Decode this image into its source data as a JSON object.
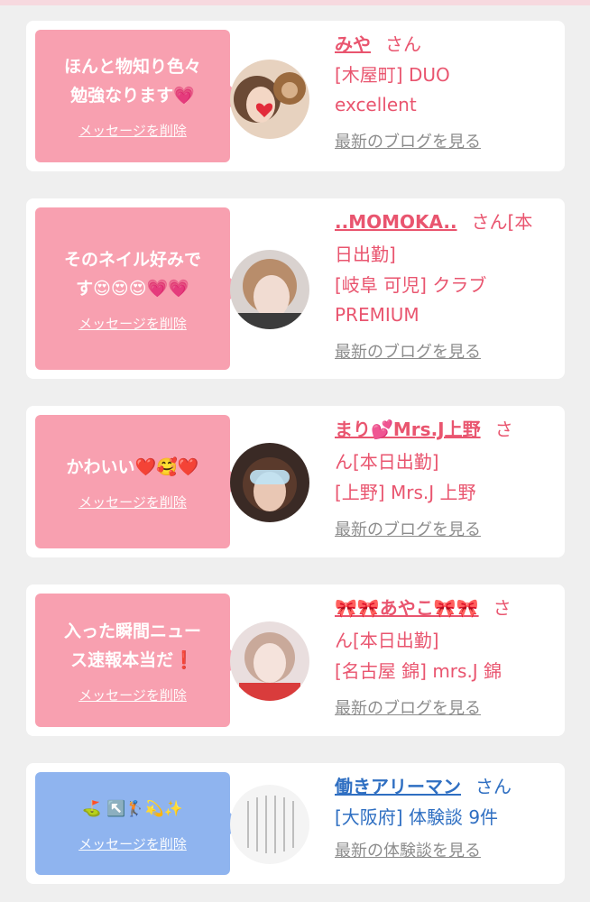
{
  "delete_label": "メッセージを削除",
  "cards": [
    {
      "message_line1": "ほんと物知り色々",
      "message_line2": "勉強なります💗",
      "name": "みや",
      "honorific": "さん",
      "detail_line1": "[木屋町] DUO",
      "detail_line2": "excellent",
      "link": "最新のブログを見る"
    },
    {
      "message_line1": "そのネイル好みで",
      "message_line2": "す😍😍😍💗💗",
      "name": "..MOMOKA..",
      "honorific": "さん[本",
      "name_cont": "日出勤]",
      "detail_line1": "[岐阜 可児] クラブ",
      "detail_line2": "PREMIUM",
      "link": "最新のブログを見る"
    },
    {
      "message_line1": "かわいい❤️🥰❤️",
      "name": "まり💕Mrs.J上野",
      "honorific": "さ",
      "name_cont": "ん[本日出勤]",
      "detail_line1": "[上野] Mrs.J 上野",
      "link": "最新のブログを見る"
    },
    {
      "message_line1": "入った瞬間ニュー",
      "message_line2": "ス速報本当だ❗",
      "name": "🎀🎀あやこ🎀🎀",
      "honorific": "さ",
      "name_cont": "ん[本日出勤]",
      "detail_line1": "[名古屋 錦] mrs.J 錦",
      "link": "最新のブログを見る"
    },
    {
      "message_line1": "⛳ ↖️🏌️💫✨",
      "name": "働きアリーマン",
      "honorific": "さん",
      "detail_line1": "[大阪府] 体験談 9件",
      "link": "最新の体験談を見る"
    }
  ],
  "colors": {
    "pink_bubble": "#f8a0b0",
    "blue_bubble": "#8fb4ef",
    "pink_text": "#e9556f",
    "blue_text": "#2f6fc2"
  }
}
